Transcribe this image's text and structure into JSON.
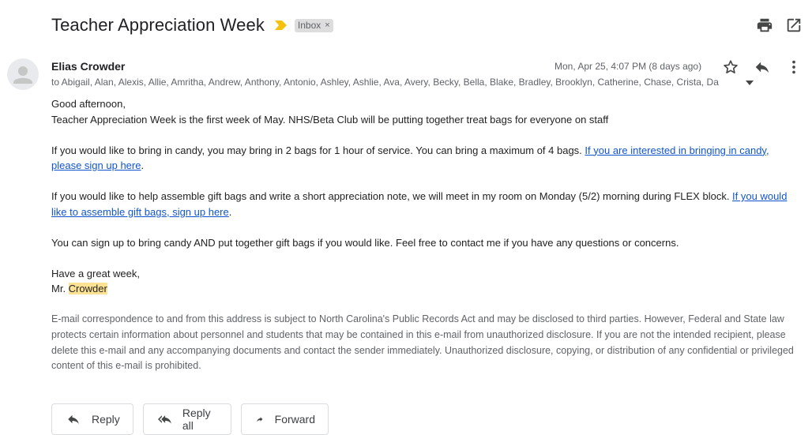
{
  "email": {
    "subject": "Teacher Appreciation Week",
    "label": "Inbox",
    "label_remove": "×",
    "sender": "Elias Crowder",
    "date": "Mon, Apr 25, 4:07 PM (8 days ago)",
    "recipients": "to Abigail, Alan, Alexis, Allie, Amritha, Andrew, Anthony, Antonio, Ashley, Ashlie, Ava, Avery, Becky, Bella, Blake, Bradley, Brooklyn, Catherine, Chase, Crista, Da",
    "body": {
      "greeting": "Good afternoon,",
      "line1": "Teacher Appreciation Week is the first week of May. NHS/Beta Club will be putting together treat bags for everyone on staff",
      "para2_text": "If you would like to bring in candy, you may bring in 2 bags for 1 hour of service. You can bring a maximum of 4 bags. ",
      "para2_link": "If you are interested in bringing in candy, please sign up here",
      "para2_end": ".",
      "para3_text": "If you would like to help assemble gift bags and write a short appreciation note, we will meet in my room on Monday (5/2) morning during FLEX block. ",
      "para3_link": "If you would like to assemble gift bags, sign up here",
      "para3_end": ".",
      "para4": "You can sign up to bring candy AND put together gift bags if you would like. Feel free to contact me if you have any questions or concerns.",
      "closing": "Have a great week,",
      "sign_prefix": "Mr. ",
      "sign_name": "Crowder"
    },
    "disclaimer": "E-mail correspondence to and from this address is subject to North Carolina's Public Records Act and may be disclosed to third parties. However, Federal and State law protects certain information about personnel and students that may be contained in this e-mail from unauthorized disclosure. If you are not the intended recipient, please delete this e-mail and any accompanying documents and contact the sender immediately. Unauthorized disclosure, copying, or distribution of any confidential or privileged content of this e-mail is prohibited."
  },
  "actions": {
    "reply": "Reply",
    "reply_all": "Reply all",
    "forward": "Forward"
  },
  "icons": {
    "importance": "importance-marker-icon",
    "print": "print-icon",
    "open_new_window": "open-in-new-window-icon",
    "star": "star-icon",
    "reply": "reply-icon",
    "more": "more-vertical-icon",
    "caret": "caret-down-icon",
    "avatar": "default-avatar-icon"
  },
  "colors": {
    "link": "#1155cc",
    "importance": "#f4c20d",
    "highlight": "#fde293"
  }
}
